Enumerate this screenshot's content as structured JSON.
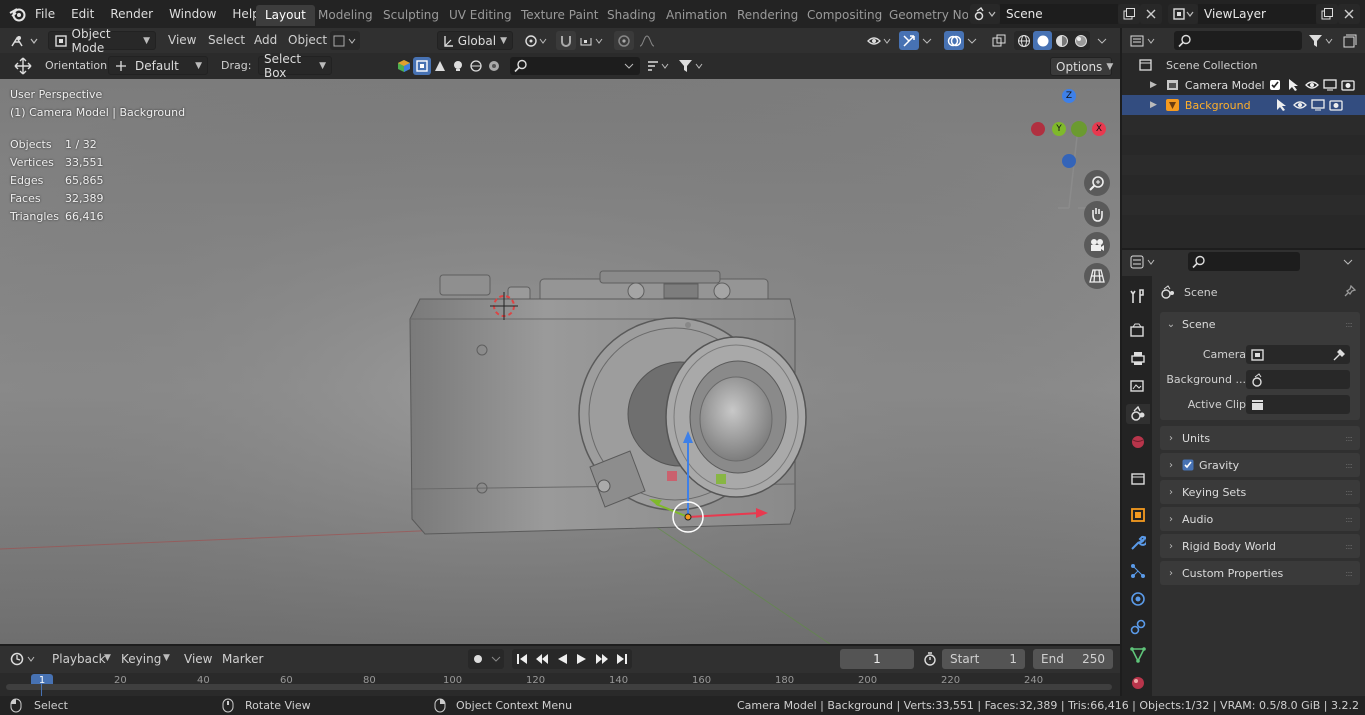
{
  "menu": {
    "items": [
      "File",
      "Edit",
      "Render",
      "Window",
      "Help"
    ]
  },
  "workspaces": [
    "Layout",
    "Modeling",
    "Sculpting",
    "UV Editing",
    "Texture Paint",
    "Shading",
    "Animation",
    "Rendering",
    "Compositing",
    "Geometry Noc"
  ],
  "scene_selector": {
    "value": "Scene"
  },
  "viewlayer_selector": {
    "value": "ViewLayer"
  },
  "header": {
    "mode": "Object Mode",
    "view": "View",
    "select": "Select",
    "add": "Add",
    "object": "Object",
    "transform_orientation": "Global"
  },
  "tool_settings": {
    "orientation_label": "Orientation:",
    "orientation_value": "Default",
    "drag_label": "Drag:",
    "drag_value": "Select Box",
    "options": "Options"
  },
  "overlay": {
    "perspective": "User Perspective",
    "context": "(1) Camera Model | Background",
    "stats": [
      {
        "label": "Objects",
        "value": "1 / 32"
      },
      {
        "label": "Vertices",
        "value": "33,551"
      },
      {
        "label": "Edges",
        "value": "65,865"
      },
      {
        "label": "Faces",
        "value": "32,389"
      },
      {
        "label": "Triangles",
        "value": "66,416"
      }
    ]
  },
  "gizmo": {
    "z": "Z",
    "y": "Y",
    "x": "X"
  },
  "timeline": {
    "playback": "Playback",
    "keying": "Keying",
    "view": "View",
    "marker": "Marker",
    "current_frame": "1",
    "start_label": "Start",
    "start": "1",
    "end_label": "End",
    "end": "250",
    "ticks": [
      "1",
      "20",
      "40",
      "60",
      "80",
      "100",
      "120",
      "140",
      "160",
      "180",
      "200",
      "220",
      "240"
    ]
  },
  "status": {
    "select": "Select",
    "rotate": "Rotate View",
    "context_menu": "Object Context Menu",
    "info": "Camera Model | Background | Verts:33,551 | Faces:32,389 | Tris:66,416 | Objects:1/32 | VRAM: 0.5/8.0 GiB | 3.2.2"
  },
  "outliner": {
    "collection": "Scene Collection",
    "items": [
      {
        "name": "Camera Model"
      },
      {
        "name": "Background"
      }
    ]
  },
  "properties": {
    "context": "Scene",
    "section": "Scene",
    "camera_label": "Camera",
    "background_label": "Background ...",
    "clip_label": "Active Clip",
    "panels": [
      "Units",
      "Gravity",
      "Keying Sets",
      "Audio",
      "Rigid Body World",
      "Custom Properties"
    ]
  },
  "colors": {
    "accent": "#4772b3",
    "selected_row": "#334d80",
    "active_text": "#ffaf29",
    "x_axis": "#e8394f",
    "y_axis": "#7fb92b",
    "z_axis": "#3e80e8"
  }
}
